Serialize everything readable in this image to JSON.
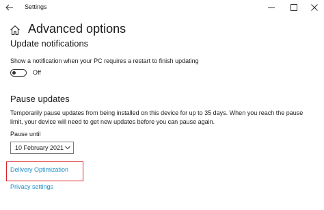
{
  "window": {
    "app_title": "Settings"
  },
  "page": {
    "title": "Advanced options"
  },
  "notifications": {
    "title": "Update notifications",
    "description": "Show a notification when your PC requires a restart to finish updating",
    "toggle_state": "Off",
    "toggle_on": false
  },
  "pause": {
    "title": "Pause updates",
    "description": "Temporarily pause updates from being installed on this device for up to 35 days. When you reach the pause limit, your device will need to get new updates before you can pause again.",
    "until_label": "Pause until",
    "until_value": "10 February 2021"
  },
  "links": {
    "delivery_optimization": "Delivery Optimization",
    "privacy_settings": "Privacy settings"
  },
  "colors": {
    "link": "#1d8fc7",
    "highlight": "#d8232a"
  },
  "icons": {
    "back": "back-arrow-icon",
    "home": "home-icon",
    "minimize": "minimize-icon",
    "maximize": "maximize-icon",
    "close": "close-icon",
    "dropdown": "chevron-down-icon"
  }
}
